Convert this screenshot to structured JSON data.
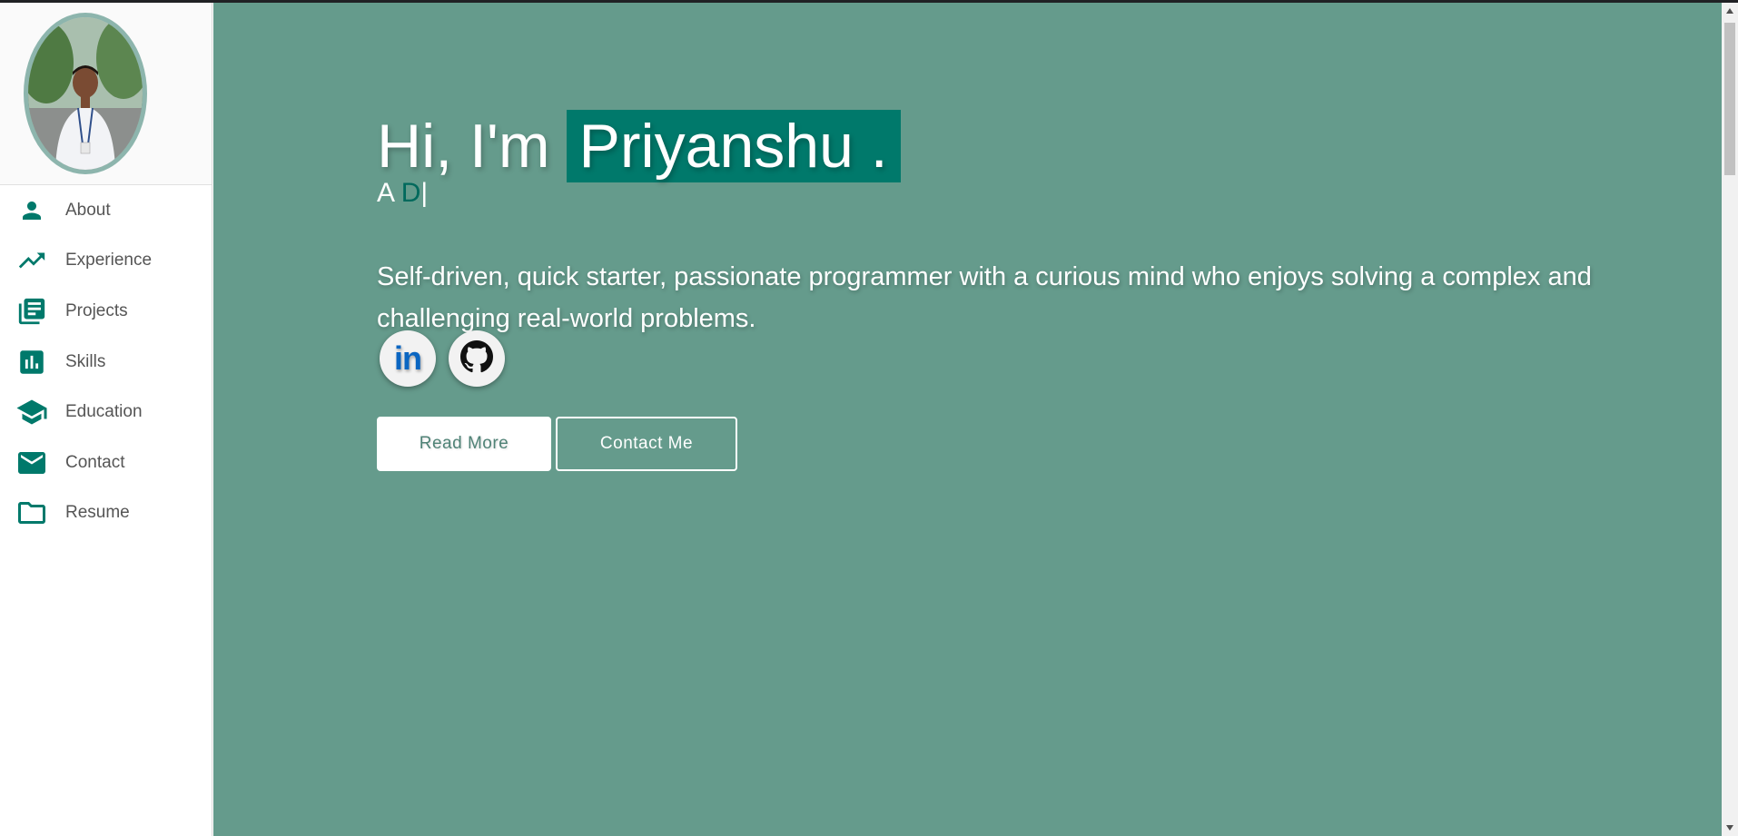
{
  "sidebar": {
    "avatar_alt": "Profile photo",
    "items": [
      {
        "label": "About",
        "icon": "person-icon"
      },
      {
        "label": "Experience",
        "icon": "trending-up-icon"
      },
      {
        "label": "Projects",
        "icon": "library-books-icon"
      },
      {
        "label": "Skills",
        "icon": "bar-chart-icon"
      },
      {
        "label": "Education",
        "icon": "school-icon"
      },
      {
        "label": "Contact",
        "icon": "mail-icon"
      },
      {
        "label": "Resume",
        "icon": "folder-icon"
      }
    ]
  },
  "hero": {
    "greeting_prefix": "Hi, I'm",
    "name": "Priyanshu .",
    "typed_prefix": "A ",
    "typed_text": "D",
    "typed_cursor": "|",
    "bio": "Self-driven, quick starter, passionate programmer with a curious mind who enjoys solving a complex and challenging real-world problems.",
    "socials": [
      {
        "name": "LinkedIn",
        "icon": "linkedin-icon",
        "glyph": "in"
      },
      {
        "name": "GitHub",
        "icon": "github-icon"
      }
    ],
    "buttons": {
      "read_more": "Read More",
      "contact_me": "Contact Me"
    }
  },
  "colors": {
    "accent": "#00796b",
    "main_background": "#659b8c",
    "icon_teal": "#00796b",
    "linkedin_blue": "#0a66c2"
  }
}
